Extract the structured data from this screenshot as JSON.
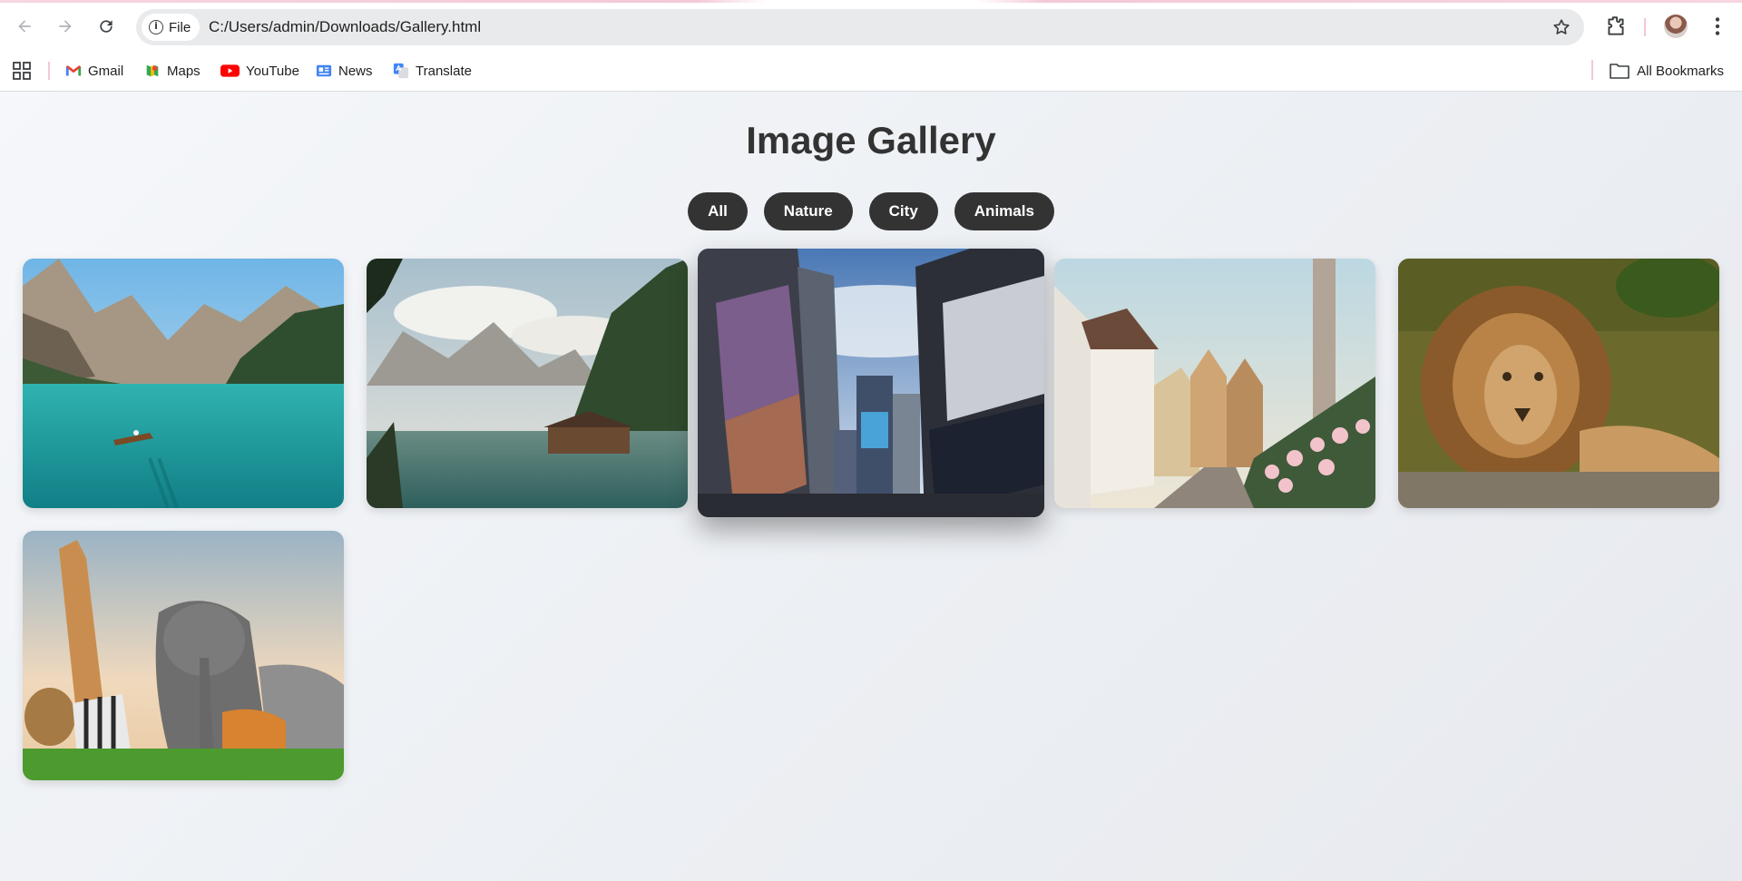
{
  "browser": {
    "url": "C:/Users/admin/Downloads/Gallery.html",
    "site_chip": "File",
    "bookmarks": [
      {
        "label": "Gmail",
        "icon": "gmail-icon"
      },
      {
        "label": "Maps",
        "icon": "maps-icon"
      },
      {
        "label": "YouTube",
        "icon": "youtube-icon"
      },
      {
        "label": "News",
        "icon": "news-icon"
      },
      {
        "label": "Translate",
        "icon": "translate-icon"
      }
    ],
    "all_bookmarks": "All Bookmarks"
  },
  "page": {
    "title": "Image Gallery",
    "filters": [
      "All",
      "Nature",
      "City",
      "Animals"
    ]
  },
  "gallery": [
    {
      "name": "lake-boat-image",
      "category": "Nature"
    },
    {
      "name": "lake-cabin-image",
      "category": "Nature"
    },
    {
      "name": "times-square-image",
      "category": "City"
    },
    {
      "name": "old-town-street-image",
      "category": "City"
    },
    {
      "name": "lion-image",
      "category": "Animals"
    },
    {
      "name": "wildlife-group-image",
      "category": "Animals"
    }
  ],
  "colors": {
    "button_bg": "#333333",
    "title": "#333333",
    "page_bg": "#f0f2f5"
  }
}
